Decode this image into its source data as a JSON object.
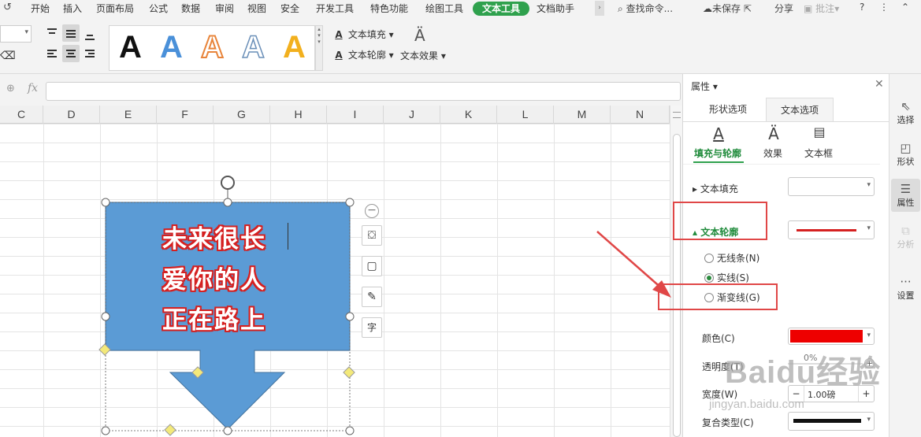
{
  "tabs": {
    "items": [
      "开始",
      "插入",
      "页面布局",
      "公式",
      "数据",
      "审阅",
      "视图",
      "安全",
      "开发工具",
      "特色功能",
      "绘图工具",
      "文本工具",
      "文档助手"
    ],
    "search": "查找命令...",
    "unsaved": "未保存",
    "share": "分享",
    "annotate": "批注",
    "help": "?"
  },
  "ribbon": {
    "wordart_glyph": "A",
    "text_fill": "文本填充",
    "text_outline": "文本轮廓",
    "text_effect": "文本效果"
  },
  "formula": {
    "fx": "fx"
  },
  "columns": [
    "C",
    "D",
    "E",
    "F",
    "G",
    "H",
    "I",
    "J",
    "K",
    "L",
    "M",
    "N"
  ],
  "shape": {
    "lines": [
      "未来很长",
      "爱你的人",
      "正在路上"
    ],
    "fill_color": "#5b9bd5",
    "outline_color": "#d52020"
  },
  "float_buttons": [
    "shape-style-icon",
    "outline-icon",
    "brush-icon",
    "text-icon"
  ],
  "panel": {
    "title": "属性",
    "tabs": [
      "形状选项",
      "文本选项"
    ],
    "subtabs": [
      "填充与轮廓",
      "效果",
      "文本框"
    ],
    "text_fill": "文本填充",
    "text_outline": "文本轮廓",
    "options": [
      "无线条(N)",
      "实线(S)",
      "渐变线(G)"
    ],
    "color_label": "颜色(C)",
    "transparency_label": "透明度(T)",
    "transparency_value": "0%",
    "width_label": "宽度(W)",
    "width_value": "1.00磅",
    "compound_label": "复合类型(C)",
    "outline_swatch": "#d52020",
    "color_swatch": "#ee0000"
  },
  "strip": [
    "选择",
    "形状",
    "属性",
    "分析",
    "设置"
  ],
  "watermark": {
    "brand": "Baidu经验",
    "url": "jingyan.baidu.com"
  }
}
